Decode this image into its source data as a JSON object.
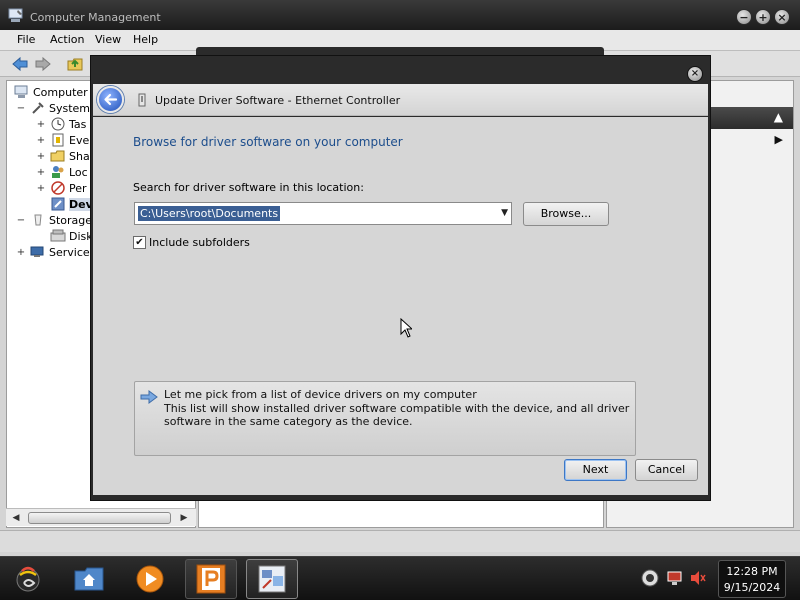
{
  "main_window": {
    "title": "Computer Management",
    "menu": [
      "File",
      "Action",
      "View",
      "Help"
    ],
    "tree": [
      {
        "label": "Computer M",
        "expander": "",
        "indent": 0,
        "icon": "computer-icon"
      },
      {
        "label": "System",
        "expander": "−",
        "indent": 1,
        "icon": "tools-icon"
      },
      {
        "label": "Tas",
        "expander": "+",
        "indent": 2,
        "icon": "clock-icon"
      },
      {
        "label": "Eve",
        "expander": "+",
        "indent": 2,
        "icon": "event-viewer-icon"
      },
      {
        "label": "Sha",
        "expander": "+",
        "indent": 2,
        "icon": "shared-folders-icon"
      },
      {
        "label": "Loc",
        "expander": "+",
        "indent": 2,
        "icon": "users-icon"
      },
      {
        "label": "Per",
        "expander": "+",
        "indent": 2,
        "icon": "performance-icon"
      },
      {
        "label": "Dev",
        "expander": "",
        "indent": 2,
        "icon": "device-manager-icon",
        "selected": true
      },
      {
        "label": "Storage",
        "expander": "−",
        "indent": 1,
        "icon": "storage-icon"
      },
      {
        "label": "Disk",
        "expander": "",
        "indent": 2,
        "icon": "disk-icon"
      },
      {
        "label": "Service",
        "expander": "+",
        "indent": 1,
        "icon": "services-icon"
      }
    ]
  },
  "dialog": {
    "title": "Update Driver Software - Ethernet Controller",
    "instruction": "Browse for driver software on your computer",
    "search_label": "Search for driver software in this location:",
    "path_value": "C:\\Users\\root\\Documents",
    "browse_label": "Browse...",
    "include_subfolders_label": "Include subfolders",
    "include_subfolders_checked": true,
    "pick_title": "Let me pick from a list of device drivers on my computer",
    "pick_description": "This list will show installed driver software compatible with the device, and all driver software in the same category as the device.",
    "next_label": "Next",
    "cancel_label": "Cancel"
  },
  "taskbar": {
    "clock_time": "12:28 PM",
    "clock_date": "9/15/2024"
  },
  "colors": {
    "instruction": "#1c4d8c",
    "selection": "#3b5f94",
    "dialog_frame": "#2b2b2b"
  }
}
